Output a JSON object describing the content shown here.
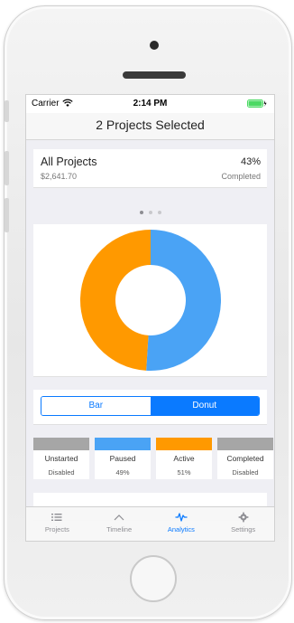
{
  "status_bar": {
    "carrier": "Carrier",
    "time": "2:14 PM"
  },
  "nav": {
    "title": "2 Projects Selected"
  },
  "summary": {
    "title": "All Projects",
    "amount": "$2,641.70",
    "percent": "43%",
    "status": "Completed"
  },
  "pager": {
    "count": 3,
    "active": 0
  },
  "chart_data": {
    "type": "pie",
    "style": "donut",
    "categories": [
      "Active",
      "Paused"
    ],
    "values": [
      51,
      49
    ],
    "colors": [
      "#4aa3f5",
      "#ff9900"
    ]
  },
  "segmented": {
    "options": [
      "Bar",
      "Donut"
    ],
    "selected": "Donut"
  },
  "stats": [
    {
      "name": "Unstarted",
      "value": "Disabled",
      "color": "#a6a6a6"
    },
    {
      "name": "Paused",
      "value": "49%",
      "color": "#4aa3f5"
    },
    {
      "name": "Active",
      "value": "51%",
      "color": "#ff9900"
    },
    {
      "name": "Completed",
      "value": "Disabled",
      "color": "#a6a6a6"
    }
  ],
  "tabs": [
    {
      "label": "Projects",
      "icon": "list-icon"
    },
    {
      "label": "Timeline",
      "icon": "timeline-icon"
    },
    {
      "label": "Analytics",
      "icon": "pulse-icon",
      "active": true
    },
    {
      "label": "Settings",
      "icon": "gear-icon"
    }
  ],
  "colors": {
    "accent": "#0a7aff",
    "tab_inactive": "#8e8e93"
  }
}
